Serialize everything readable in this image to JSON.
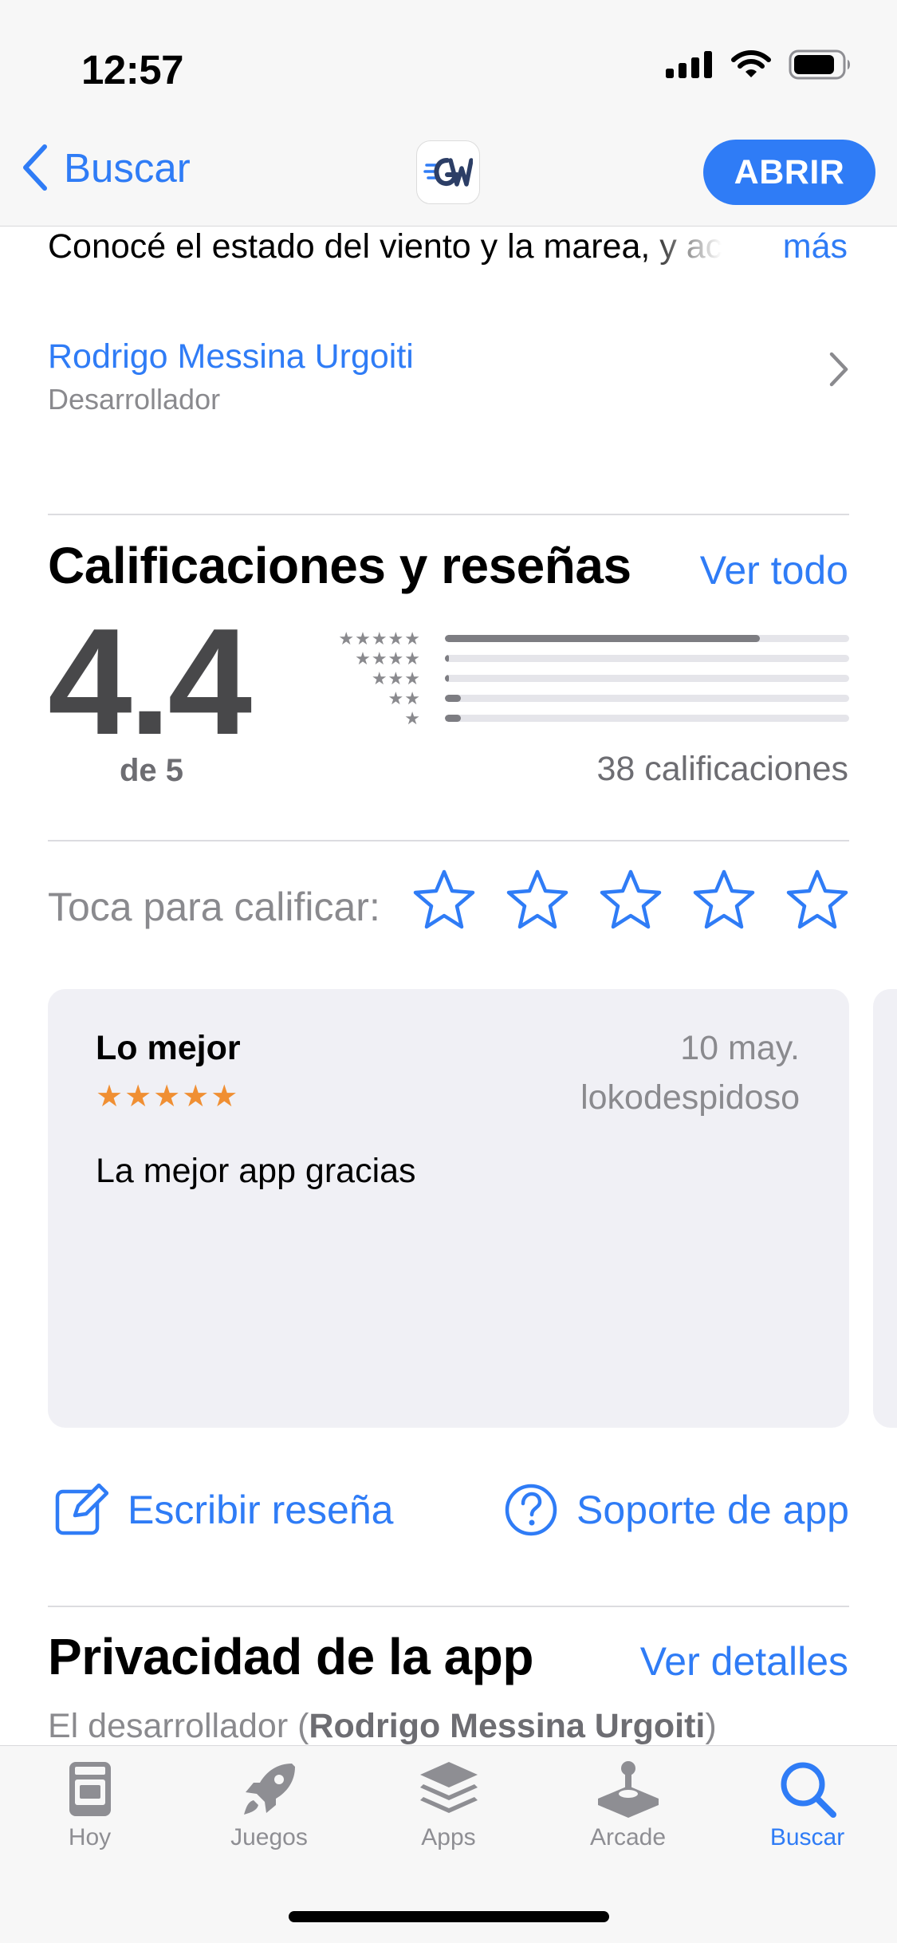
{
  "status_bar": {
    "time": "12:57"
  },
  "nav": {
    "back_label": "Buscar",
    "open_label": "ABRIR"
  },
  "description": {
    "text": "Conocé el estado del viento y la marea, y acceder",
    "more": "más"
  },
  "developer": {
    "name": "Rodrigo Messina Urgoiti",
    "role": "Desarrollador"
  },
  "ratings": {
    "title": "Calificaciones y reseñas",
    "see_all": "Ver todo",
    "average": "4.4",
    "out_of": "de 5",
    "count_label": "38 calificaciones",
    "histogram": [
      {
        "stars": "★★★★★",
        "fraction": 0.78
      },
      {
        "stars": "★★★★",
        "fraction": 0.01
      },
      {
        "stars": "★★★",
        "fraction": 0.01
      },
      {
        "stars": "★★",
        "fraction": 0.04
      },
      {
        "stars": "★",
        "fraction": 0.04
      }
    ],
    "tap_to_rate": "Toca para calificar:"
  },
  "review": {
    "title": "Lo mejor",
    "stars": "★★★★★",
    "date": "10 may.",
    "author": "lokodespidoso",
    "body": "La mejor app gracias"
  },
  "actions": {
    "write_review": "Escribir reseña",
    "app_support": "Soporte de app"
  },
  "privacy": {
    "title": "Privacidad de la app",
    "see_details": "Ver detalles",
    "subtitle_prefix": "El desarrollador (",
    "subtitle_name": "Rodrigo Messina Urgoiti",
    "subtitle_suffix": ")"
  },
  "tabs": [
    {
      "label": "Hoy",
      "icon": "today-icon",
      "active": false
    },
    {
      "label": "Juegos",
      "icon": "rocket-icon",
      "active": false
    },
    {
      "label": "Apps",
      "icon": "apps-stack-icon",
      "active": false
    },
    {
      "label": "Arcade",
      "icon": "joystick-icon",
      "active": false
    },
    {
      "label": "Buscar",
      "icon": "search-icon",
      "active": true
    }
  ],
  "colors": {
    "accent": "#2f7cf6",
    "star_orange": "#f08f33",
    "card_bg": "#f0f0f5"
  }
}
